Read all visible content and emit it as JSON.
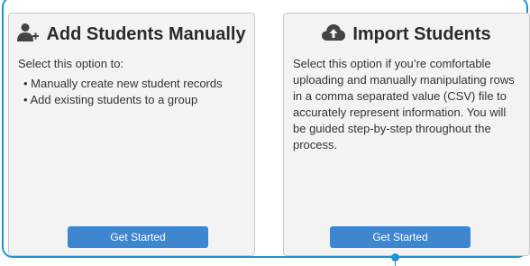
{
  "colors": {
    "accent": "#1a95d1",
    "button": "#3e86cf",
    "card_bg": "#f3f3f3"
  },
  "manual": {
    "icon": "add-user-icon",
    "title": "Add Students Manually",
    "intro": "Select this option to:",
    "items": [
      "Manually create new student records",
      "Add existing students to a group"
    ],
    "button_label": "Get Started"
  },
  "import": {
    "icon": "cloud-upload-icon",
    "title": "Import Students",
    "description": "Select this option if you’re comfortable uploading and manually manipulating rows in a comma separated value (CSV) file to accurately represent information. You will be guided step-by-step throughout the process.",
    "button_label": "Get Started"
  }
}
